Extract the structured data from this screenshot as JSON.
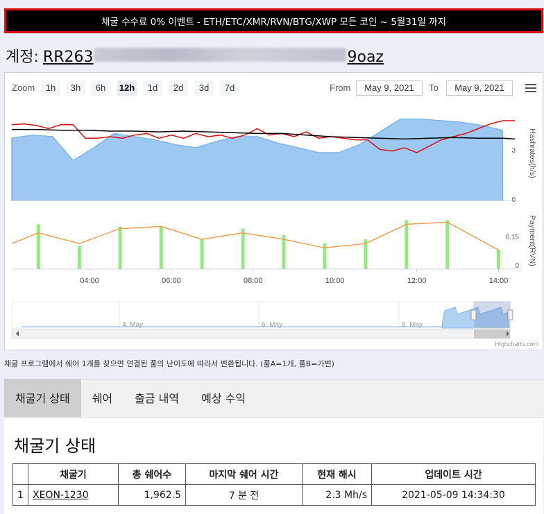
{
  "banner": "채굴 수수료 0% 이벤트 - ETH/ETC/XMR/RVN/BTG/XWP 모든 코인 ~ 5월31일 까지",
  "account": {
    "label": "계정:",
    "addr_start": "RR263",
    "addr_end": "9oaz"
  },
  "range_selector": {
    "zoom_label": "Zoom",
    "buttons": [
      "1h",
      "3h",
      "6h",
      "12h",
      "1d",
      "2d",
      "3d",
      "7d"
    ],
    "active": "12h",
    "from_label": "From",
    "from_value": "May 9, 2021",
    "to_label": "To",
    "to_value": "May 9, 2021"
  },
  "colors": {
    "area": "#7cb5ec",
    "red": "#e01010",
    "black": "#000000",
    "column": "#90ed7d",
    "payment_line": "#f0a050",
    "banner_border": "#e01010"
  },
  "chart_data": [
    {
      "type": "area",
      "ylabel": "Hashrates(h/s)",
      "yticks": [
        "3",
        "0"
      ],
      "series": [
        {
          "x": [
            2.1,
            2.6,
            3.1,
            3.6,
            4.1,
            4.6,
            5.1,
            5.6,
            6.1,
            6.6,
            7.1,
            7.6,
            8.1,
            8.6,
            9.1,
            9.6,
            10.1,
            10.6,
            11.1,
            11.6,
            12.1,
            12.6,
            13.1,
            13.6,
            14.1
          ],
          "values": [
            3.9,
            4.1,
            4.0,
            2.5,
            3.3,
            4.2,
            4.0,
            3.8,
            3.5,
            3.3,
            3.7,
            4.0,
            4.0,
            3.6,
            3.3,
            3.0,
            3.0,
            3.5,
            4.3,
            5.1,
            5.1,
            5.0,
            4.9,
            4.7,
            4.4
          ]
        },
        {
          "x": [
            2.1,
            2.4,
            2.7,
            3.0,
            3.3,
            3.6,
            3.9,
            4.2,
            4.5,
            4.8,
            5.1,
            5.4,
            5.7,
            6.0,
            6.3,
            6.6,
            6.9,
            7.2,
            7.5,
            7.8,
            8.1,
            8.4,
            8.7,
            9.0,
            9.3,
            9.6,
            9.9,
            10.2,
            10.5,
            10.8,
            11.1,
            11.4,
            11.7,
            12.0,
            12.3,
            12.6,
            12.9,
            13.2,
            13.5,
            13.8,
            14.1,
            14.4
          ],
          "values": [
            4.75,
            4.8,
            4.7,
            4.5,
            4.75,
            4.75,
            3.9,
            3.9,
            4.0,
            3.9,
            4.1,
            4.2,
            3.9,
            4.1,
            3.9,
            4.2,
            4.0,
            4.1,
            3.9,
            4.1,
            4.5,
            4.1,
            4.2,
            4.0,
            4.3,
            3.9,
            4.0,
            3.9,
            3.8,
            3.8,
            3.2,
            3.1,
            3.3,
            3.0,
            3.4,
            3.8,
            4.0,
            4.2,
            4.5,
            4.8,
            5.0,
            5.0
          ]
        },
        {
          "x": [
            2.1,
            2.7,
            3.3,
            3.9,
            4.5,
            5.1,
            5.7,
            6.3,
            6.9,
            7.5,
            8.1,
            8.7,
            9.3,
            9.9,
            10.5,
            11.1,
            11.7,
            12.3,
            12.9,
            13.5,
            14.1,
            14.4
          ],
          "values": [
            4.45,
            4.45,
            4.4,
            4.4,
            4.35,
            4.35,
            4.3,
            4.35,
            4.3,
            4.25,
            4.2,
            4.2,
            4.1,
            4.0,
            3.95,
            3.9,
            3.85,
            3.9,
            3.95,
            3.9,
            3.9,
            3.85
          ]
        }
      ],
      "ylim": [
        0,
        6
      ]
    },
    {
      "type": "bar",
      "ylabel": "Payment(RVN)",
      "yticks": [
        "0.15",
        "0"
      ],
      "x": [
        2.75,
        3.75,
        4.75,
        5.75,
        6.75,
        7.75,
        8.75,
        9.75,
        10.75,
        11.75,
        12.75,
        14.0
      ],
      "values": [
        0.21,
        0.11,
        0.2,
        0.2,
        0.14,
        0.19,
        0.16,
        0.12,
        0.14,
        0.23,
        0.23,
        0.09
      ],
      "line_x": [
        2.1,
        2.75,
        3.75,
        4.75,
        5.75,
        6.75,
        7.75,
        8.75,
        9.75,
        10.75,
        11.75,
        12.75,
        14.0
      ],
      "line_values": [
        0.12,
        0.17,
        0.12,
        0.19,
        0.2,
        0.14,
        0.17,
        0.14,
        0.1,
        0.12,
        0.21,
        0.22,
        0.09
      ],
      "ylim": [
        0,
        0.27
      ]
    }
  ],
  "xaxis": {
    "ticks": [
      "04:00",
      "06:00",
      "08:00",
      "10:00",
      "12:00",
      "14:00"
    ],
    "tick_values": [
      4,
      6,
      8,
      10,
      12,
      14
    ]
  },
  "navigator": {
    "labels": [
      "4. May",
      "6. May",
      "8. May"
    ]
  },
  "credit": "Highcharts.com",
  "note": "채굴 프로그램에서 쉐어 1개를 찾으면 연결된 풀의 난이도에 따라서 변환됩니다. (풀A=1개, 풀B=가변)",
  "tabs": [
    "채굴기 상태",
    "쉐어",
    "출금 내역",
    "예상 수익"
  ],
  "active_tab": "채굴기 상태",
  "section_title": "채굴기 상태",
  "table": {
    "headers": [
      "",
      "채굴기",
      "총 쉐어수",
      "마지막 쉐어 시간",
      "현재 해시",
      "업데이트 시간"
    ],
    "rows": [
      {
        "idx": "1",
        "name": "XEON-1230",
        "shares": "1,962.5",
        "last_share": "7 분 전",
        "hash": "2.3 Mh/s",
        "updated": "2021-05-09 14:34:30"
      }
    ]
  }
}
